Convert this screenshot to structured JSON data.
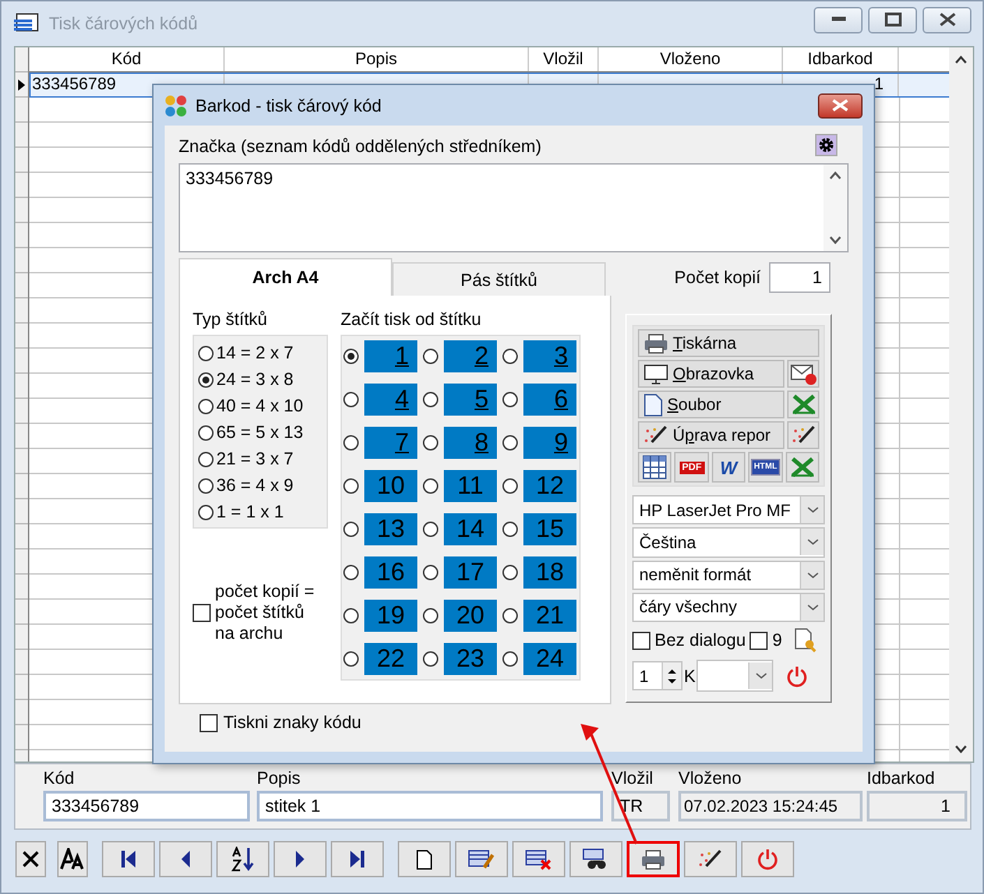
{
  "window": {
    "title": "Tisk čárových kódů"
  },
  "table": {
    "columns": [
      "Kód",
      "Popis",
      "Vložil",
      "Vloženo",
      "Idbarkod"
    ],
    "rows": [
      {
        "selected": true,
        "kod": "333456789",
        "idbarkod": "1"
      }
    ]
  },
  "detail": {
    "fields": [
      {
        "label": "Kód",
        "value": "333456789",
        "disabled": false,
        "numeric": false
      },
      {
        "label": "Popis",
        "value": "stitek 1",
        "disabled": false,
        "numeric": false
      },
      {
        "label": "Vložil",
        "value": "TR",
        "disabled": true,
        "numeric": false
      },
      {
        "label": "Vloženo",
        "value": "07.02.2023 15:24:45",
        "disabled": true,
        "numeric": false
      },
      {
        "label": "Idbarkod",
        "value": "1",
        "disabled": true,
        "numeric": true
      }
    ]
  },
  "toolbar": {
    "groups": [
      {
        "buttons": [
          {
            "kind": "cancel",
            "highlighted": false
          },
          {
            "kind": "font",
            "highlighted": false
          }
        ]
      },
      {
        "buttons": [
          {
            "kind": "first",
            "highlighted": false
          },
          {
            "kind": "prev",
            "highlighted": false
          },
          {
            "kind": "sort",
            "highlighted": false
          },
          {
            "kind": "next",
            "highlighted": false
          },
          {
            "kind": "last",
            "highlighted": false
          }
        ]
      },
      {
        "buttons": [
          {
            "kind": "new",
            "highlighted": false
          },
          {
            "kind": "edit",
            "highlighted": false
          },
          {
            "kind": "delete",
            "highlighted": false
          },
          {
            "kind": "find",
            "highlighted": false
          },
          {
            "kind": "print",
            "highlighted": true
          },
          {
            "kind": "wizard",
            "highlighted": false
          },
          {
            "kind": "power",
            "highlighted": false
          }
        ]
      }
    ]
  },
  "dialog": {
    "title": "Barkod - tisk čárový kód",
    "codes": {
      "label": "Značka (seznam kódů oddělených středníkem)",
      "value": "333456789"
    },
    "tabs": [
      {
        "label": "Arch A4",
        "selected": true
      },
      {
        "label": "Pás štítků",
        "selected": false
      }
    ],
    "copies": {
      "label": "Počet kopií",
      "value": "1"
    },
    "label_type": {
      "title": "Typ štítků",
      "options": [
        {
          "label": "14 = 2 x 7",
          "selected": false
        },
        {
          "label": "24 = 3 x 8",
          "selected": true
        },
        {
          "label": "40 = 4 x 10",
          "selected": false
        },
        {
          "label": "65 = 5 x 13",
          "selected": false
        },
        {
          "label": "21 = 3 x 7",
          "selected": false
        },
        {
          "label": "36 = 4 x 9",
          "selected": false
        },
        {
          "label": "1 = 1 x 1",
          "selected": false
        }
      ]
    },
    "start": {
      "title": "Začít tisk od štítku",
      "cells": [
        {
          "number": "1",
          "selected": true,
          "underlined": true
        },
        {
          "number": "2",
          "selected": false,
          "underlined": true
        },
        {
          "number": "3",
          "selected": false,
          "underlined": true
        },
        {
          "number": "4",
          "selected": false,
          "underlined": true
        },
        {
          "number": "5",
          "selected": false,
          "underlined": true
        },
        {
          "number": "6",
          "selected": false,
          "underlined": true
        },
        {
          "number": "7",
          "selected": false,
          "underlined": true
        },
        {
          "number": "8",
          "selected": false,
          "underlined": true
        },
        {
          "number": "9",
          "selected": false,
          "underlined": true
        },
        {
          "number": "10",
          "selected": false,
          "underlined": false
        },
        {
          "number": "11",
          "selected": false,
          "underlined": false
        },
        {
          "number": "12",
          "selected": false,
          "underlined": false
        },
        {
          "number": "13",
          "selected": false,
          "underlined": false
        },
        {
          "number": "14",
          "selected": false,
          "underlined": false
        },
        {
          "number": "15",
          "selected": false,
          "underlined": false
        },
        {
          "number": "16",
          "selected": false,
          "underlined": false
        },
        {
          "number": "17",
          "selected": false,
          "underlined": false
        },
        {
          "number": "18",
          "selected": false,
          "underlined": false
        },
        {
          "number": "19",
          "selected": false,
          "underlined": false
        },
        {
          "number": "20",
          "selected": false,
          "underlined": false
        },
        {
          "number": "21",
          "selected": false,
          "underlined": false
        },
        {
          "number": "22",
          "selected": false,
          "underlined": false
        },
        {
          "number": "23",
          "selected": false,
          "underlined": false
        },
        {
          "number": "24",
          "selected": false,
          "underlined": false
        }
      ]
    },
    "copies_equal": {
      "label": "počet kopií = počet štítků na archu",
      "checked": false
    },
    "print_chars": {
      "label": "Tiskni znaky kódu",
      "checked": false
    },
    "output_buttons": [
      {
        "kind": "printer",
        "key": "T",
        "post": "iskárna"
      },
      {
        "kind": "screen",
        "key": "O",
        "post": "brazovka",
        "side": {
          "kind": "mail"
        }
      },
      {
        "kind": "file",
        "key": "S",
        "post": "oubor",
        "side": {
          "kind": "excel"
        }
      },
      {
        "kind": "wand",
        "pre": "Ú",
        "key": "p",
        "post": "rava repor",
        "side": {
          "kind": "wizard"
        }
      }
    ],
    "icon_buttons": [
      {
        "kind": "grid"
      },
      {
        "kind": "pdf",
        "text": "PDF"
      },
      {
        "kind": "word",
        "text": "W"
      },
      {
        "kind": "html",
        "text": "HTML"
      },
      {
        "kind": "excel"
      }
    ],
    "dropdowns": [
      "HP LaserJet Pro MF",
      "Čeština",
      "neměnit formát",
      "čáry všechny"
    ],
    "no_dialog": {
      "label": "Bez dialogu",
      "checked": false
    },
    "nine": {
      "label": "9",
      "checked": false
    },
    "spin": {
      "value": "1",
      "suffix": "K"
    }
  }
}
